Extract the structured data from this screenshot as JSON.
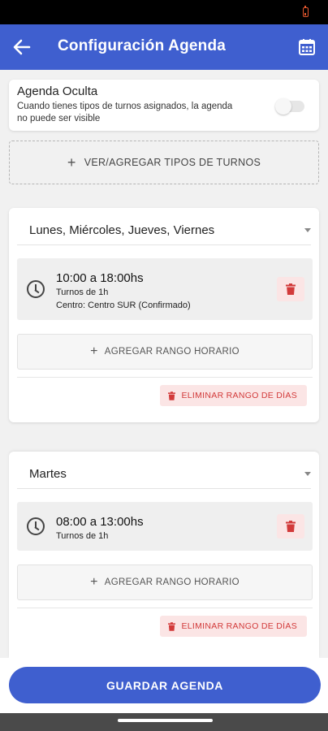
{
  "app_bar": {
    "title": "Configuración Agenda",
    "back_icon": "arrow-left-icon",
    "calendar_icon": "calendar-icon"
  },
  "hidden_agenda": {
    "title": "Agenda Oculta",
    "description": "Cuando tienes tipos de turnos asignados, la agenda no puede ser visible",
    "toggle_on": false
  },
  "add_types_label": "VER/AGREGAR TIPOS DE TURNOS",
  "day_groups": [
    {
      "days": "Lunes, Miércoles, Jueves, Viernes",
      "ranges": [
        {
          "time": "10:00 a 18:00hs",
          "turns": "Turnos de 1h",
          "center": "Centro: Centro SUR (Confirmado)"
        }
      ],
      "add_range_label": "AGREGAR RANGO HORARIO",
      "delete_days_label": "ELIMINAR RANGO DE DÍAS"
    },
    {
      "days": "Martes",
      "ranges": [
        {
          "time": "08:00 a 13:00hs",
          "turns": "Turnos de 1h"
        }
      ],
      "add_range_label": "AGREGAR RANGO HORARIO",
      "delete_days_label": "ELIMINAR RANGO DE DÍAS"
    }
  ],
  "save_label": "GUARDAR AGENDA",
  "colors": {
    "primary": "#3f5fcf",
    "danger": "#d23a3a",
    "danger_bg": "#fbe5e5"
  }
}
